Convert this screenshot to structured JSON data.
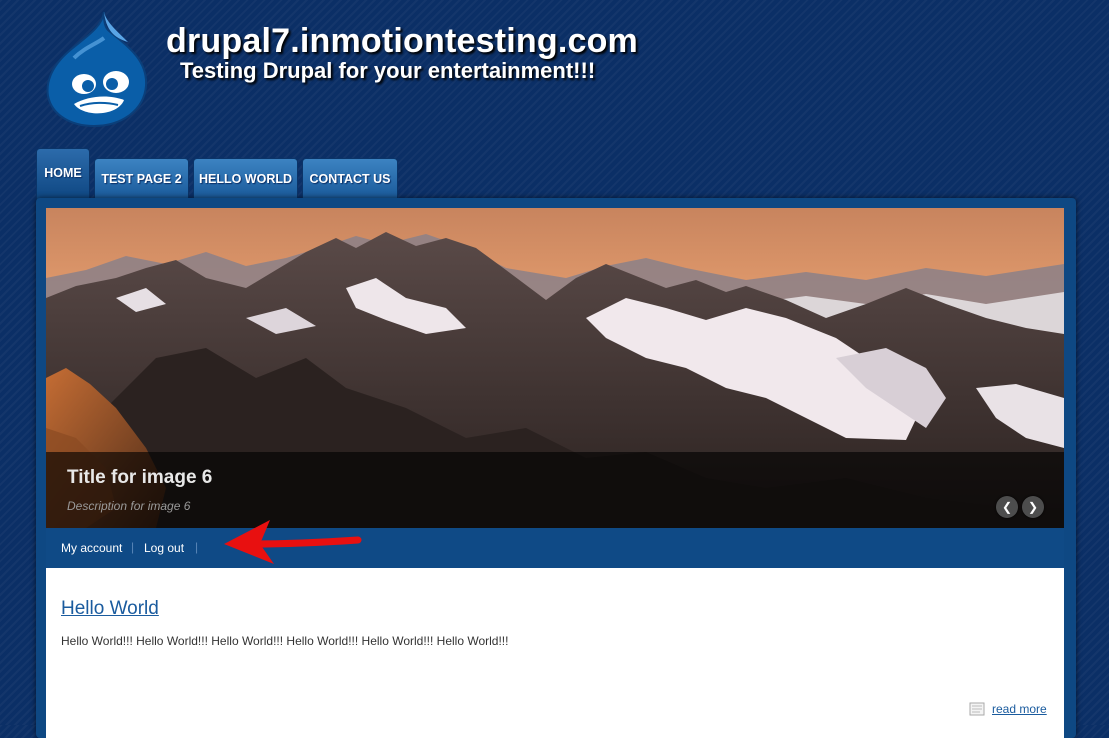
{
  "header": {
    "site_name": "drupal7.inmotiontesting.com",
    "slogan": "Testing Drupal for your entertainment!!!",
    "logo_icon": "drupal-drop-logo-icon"
  },
  "nav": {
    "tabs": [
      {
        "label": "HOME",
        "active": true
      },
      {
        "label": "TEST PAGE 2",
        "active": false
      },
      {
        "label": "HELLO WORLD",
        "active": false
      },
      {
        "label": "CONTACT US",
        "active": false
      }
    ]
  },
  "slideshow": {
    "title": "Title for image 6",
    "description": "Description for image 6",
    "prev_icon": "chevron-left-icon",
    "next_icon": "chevron-right-icon",
    "prev_glyph": "❮",
    "next_glyph": "❯"
  },
  "secondary_menu": {
    "items": [
      "My account",
      "Log out"
    ],
    "separator": "|"
  },
  "node": {
    "title": "Hello World",
    "body": "Hello World!!! Hello World!!! Hello World!!! Hello World!!! Hello World!!! Hello World!!!",
    "read_more": "read more"
  },
  "colors": {
    "background": "#0b2f66",
    "panel": "#0e4883",
    "link": "#1a5b9e",
    "annotation_arrow": "#e81010"
  }
}
